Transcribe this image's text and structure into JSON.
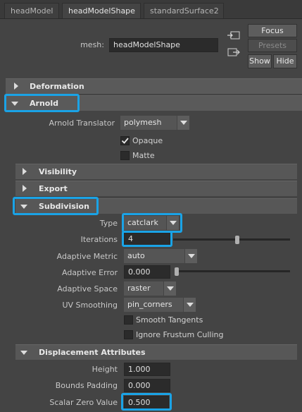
{
  "tabs": [
    {
      "label": "headModel"
    },
    {
      "label": "headModelShape"
    },
    {
      "label": "standardSurface2"
    }
  ],
  "header": {
    "mesh_label": "mesh:",
    "mesh_value": "headModelShape",
    "focus_label": "Focus",
    "presets_label": "Presets",
    "show_label": "Show",
    "hide_label": "Hide"
  },
  "sections": {
    "deformation": "Deformation",
    "arnold": "Arnold",
    "visibility": "Visibility",
    "export": "Export",
    "subdivision": "Subdivision",
    "displacement": "Displacement Attributes"
  },
  "arnold": {
    "translator_label": "Arnold Translator",
    "translator_value": "polymesh",
    "opaque_label": "Opaque",
    "opaque_checked": true,
    "matte_label": "Matte",
    "matte_checked": false
  },
  "subdivision": {
    "type_label": "Type",
    "type_value": "catclark",
    "iterations_label": "Iterations",
    "iterations_value": "4",
    "iterations_slider_fraction": 0.55,
    "adaptive_metric_label": "Adaptive Metric",
    "adaptive_metric_value": "auto",
    "adaptive_error_label": "Adaptive Error",
    "adaptive_error_value": "0.000",
    "adaptive_error_slider_fraction": 0.0,
    "adaptive_space_label": "Adaptive Space",
    "adaptive_space_value": "raster",
    "uv_smoothing_label": "UV Smoothing",
    "uv_smoothing_value": "pin_corners",
    "smooth_tangents_label": "Smooth Tangents",
    "ignore_frustum_label": "Ignore Frustum Culling"
  },
  "displacement": {
    "height_label": "Height",
    "height_value": "1.000",
    "bounds_label": "Bounds Padding",
    "bounds_value": "0.000",
    "scalar_zero_label": "Scalar Zero Value",
    "scalar_zero_value": "0.500"
  },
  "colors": {
    "highlight": "#1aa3e6",
    "background": "#444444",
    "section_bar": "#5a5a5a"
  }
}
